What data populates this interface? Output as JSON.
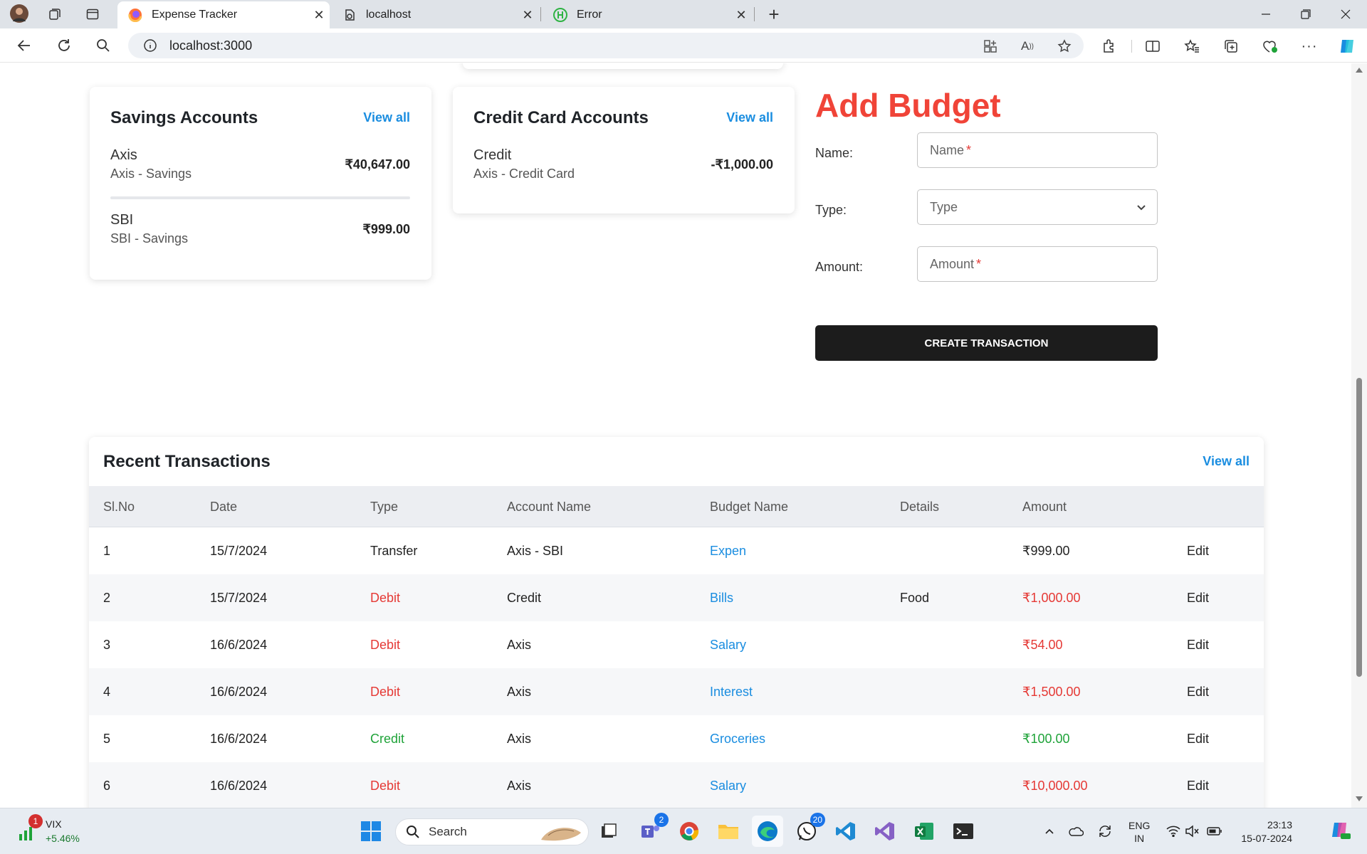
{
  "browser": {
    "tabs": [
      {
        "title": "Expense Tracker",
        "active": true
      },
      {
        "title": "localhost",
        "active": false
      },
      {
        "title": "Error",
        "active": false
      }
    ],
    "new_tab": "+",
    "url": "localhost:3000"
  },
  "savings": {
    "title": "Savings Accounts",
    "view_all": "View all",
    "accounts": [
      {
        "name": "Axis",
        "sub": "Axis - Savings",
        "amount": "₹40,647.00"
      },
      {
        "name": "SBI",
        "sub": "SBI - Savings",
        "amount": "₹999.00"
      }
    ]
  },
  "credit": {
    "title": "Credit Card Accounts",
    "view_all": "View all",
    "accounts": [
      {
        "name": "Credit",
        "sub": "Axis - Credit Card",
        "amount": "-₹1,000.00"
      }
    ]
  },
  "budget_form": {
    "title": "Add Budget",
    "name_label": "Name:",
    "name_placeholder": "Name",
    "type_label": "Type:",
    "type_placeholder": "Type",
    "amount_label": "Amount:",
    "amount_placeholder": "Amount",
    "required_mark": "*",
    "submit": "CREATE TRANSACTION"
  },
  "transactions": {
    "title": "Recent Transactions",
    "view_all": "View all",
    "columns": [
      "Sl.No",
      "Date",
      "Type",
      "Account Name",
      "Budget Name",
      "Details",
      "Amount"
    ],
    "rows": [
      {
        "no": "1",
        "date": "15/7/2024",
        "type": "Transfer",
        "account": "Axis - SBI",
        "budget": "Expen",
        "details": "",
        "amount": "₹999.00",
        "action": "Edit"
      },
      {
        "no": "2",
        "date": "15/7/2024",
        "type": "Debit",
        "account": "Credit",
        "budget": "Bills",
        "details": "Food",
        "amount": "₹1,000.00",
        "action": "Edit"
      },
      {
        "no": "3",
        "date": "16/6/2024",
        "type": "Debit",
        "account": "Axis",
        "budget": "Salary",
        "details": "",
        "amount": "₹54.00",
        "action": "Edit"
      },
      {
        "no": "4",
        "date": "16/6/2024",
        "type": "Debit",
        "account": "Axis",
        "budget": "Interest",
        "details": "",
        "amount": "₹1,500.00",
        "action": "Edit"
      },
      {
        "no": "5",
        "date": "16/6/2024",
        "type": "Credit",
        "account": "Axis",
        "budget": "Groceries",
        "details": "",
        "amount": "₹100.00",
        "action": "Edit"
      },
      {
        "no": "6",
        "date": "16/6/2024",
        "type": "Debit",
        "account": "Axis",
        "budget": "Salary",
        "details": "",
        "amount": "₹10,000.00",
        "action": "Edit"
      }
    ]
  },
  "taskbar": {
    "ticker_name": "VIX",
    "ticker_change": "+5.46%",
    "ticker_badge": "1",
    "search_placeholder": "Search",
    "teams_badge": "2",
    "whatsapp_badge": "20",
    "lang_top": "ENG",
    "lang_bottom": "IN",
    "time": "23:13",
    "date": "15-07-2024"
  },
  "colors": {
    "accent": "#1a8de0",
    "debit": "#e53935",
    "credit": "#1fa339",
    "title_red": "#f04438",
    "button": "#1c1c1c"
  }
}
